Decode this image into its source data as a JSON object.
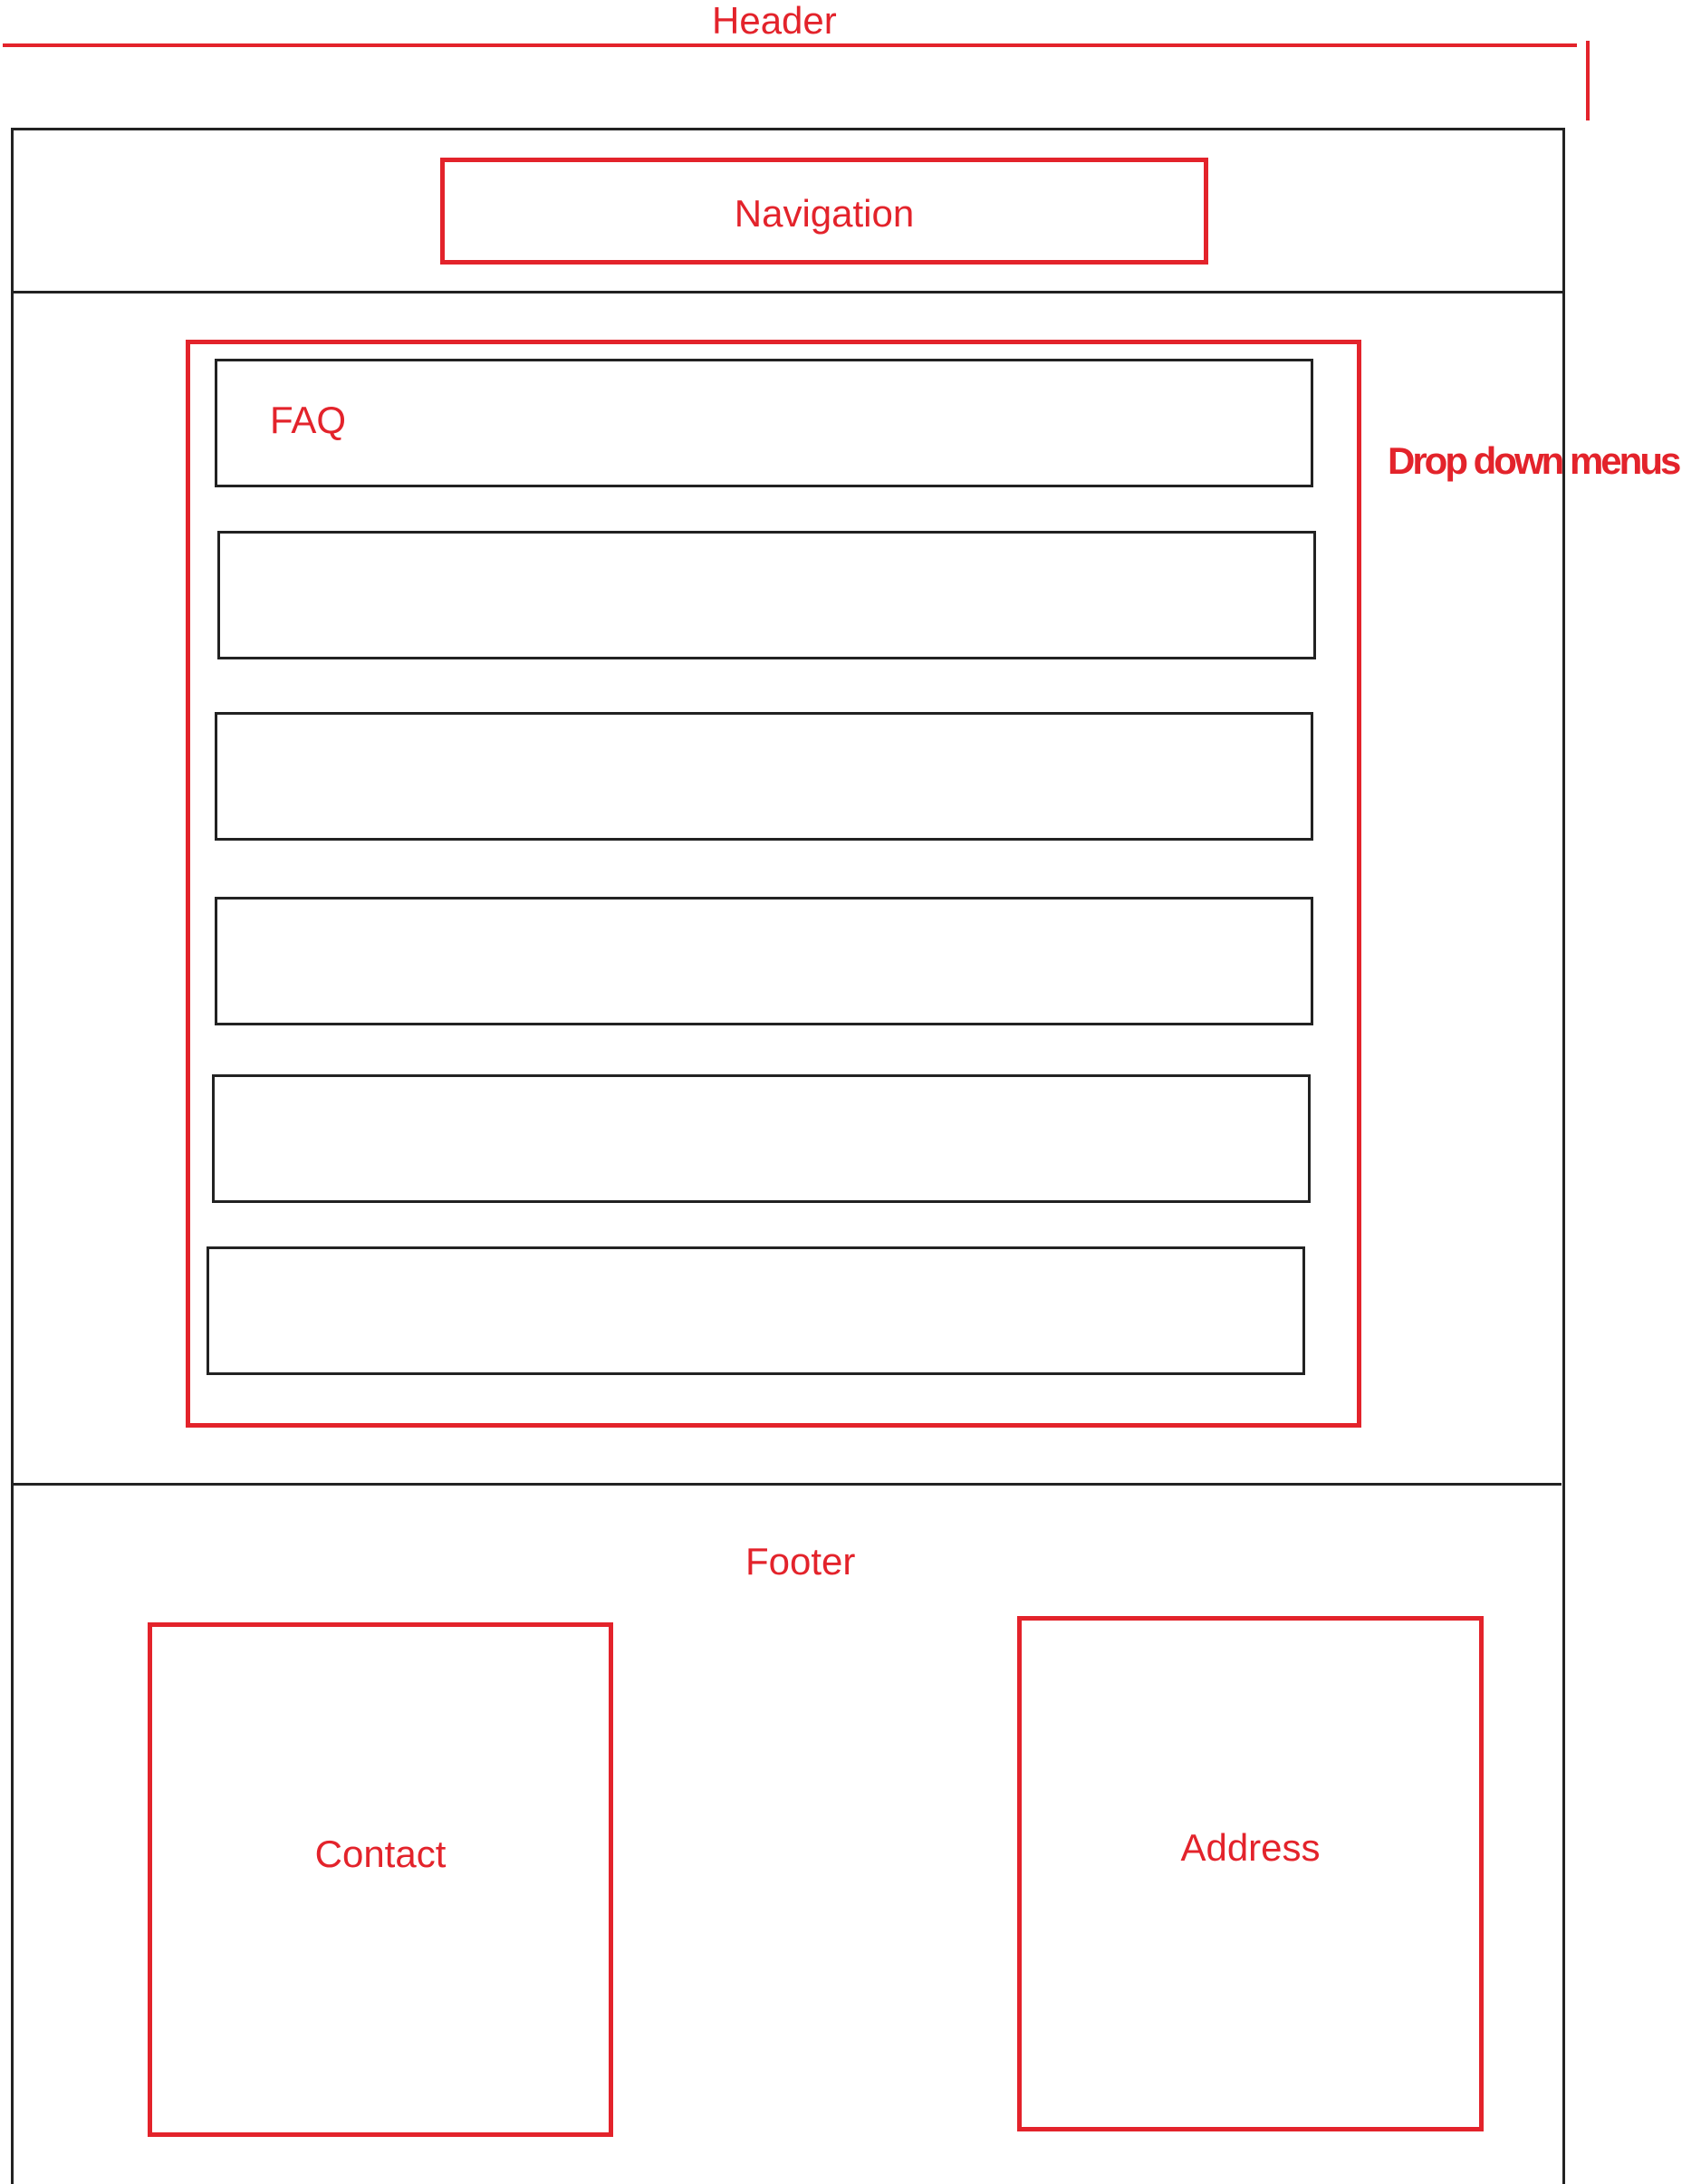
{
  "annotations": {
    "header": "Header",
    "dropdown_menus": "Drop down menus"
  },
  "navigation": {
    "label": "Navigation"
  },
  "faq": {
    "items": [
      {
        "label": "FAQ"
      },
      {
        "label": ""
      },
      {
        "label": ""
      },
      {
        "label": ""
      },
      {
        "label": ""
      },
      {
        "label": ""
      }
    ]
  },
  "footer": {
    "label": "Footer",
    "contact_label": "Contact",
    "address_label": "Address"
  },
  "colors": {
    "annotation_red": "#e3232b",
    "wireframe_line": "#222222",
    "background": "#ffffff"
  }
}
